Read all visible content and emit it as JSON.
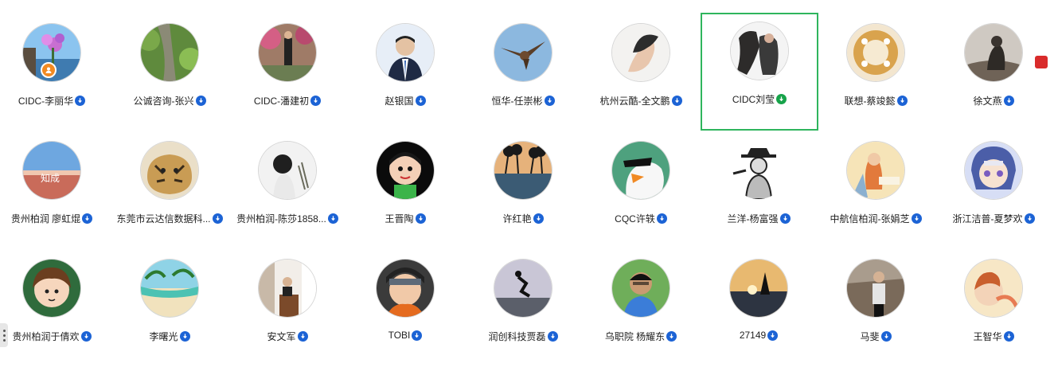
{
  "contacts": [
    {
      "name": "CIDC-李丽华",
      "badge": "blue",
      "selected": false
    },
    {
      "name": "公诚咨询-张兴",
      "badge": "blue",
      "selected": false
    },
    {
      "name": "CIDC-潘建初",
      "badge": "blue",
      "selected": false
    },
    {
      "name": "赵银国",
      "badge": "blue",
      "selected": false
    },
    {
      "name": "恒华-任崇彬",
      "badge": "blue",
      "selected": false
    },
    {
      "name": "杭州云酷-全文鹏",
      "badge": "blue",
      "selected": false
    },
    {
      "name": "CIDC刘莹",
      "badge": "green",
      "selected": true
    },
    {
      "name": "联想-蔡竣懿",
      "badge": "blue",
      "selected": false
    },
    {
      "name": "徐文燕",
      "badge": "blue",
      "selected": false
    },
    {
      "name": "贵州柏润 廖虹焜",
      "badge": "blue",
      "selected": false
    },
    {
      "name": "东莞市云达信数据科...",
      "badge": "blue",
      "selected": false
    },
    {
      "name": "贵州柏润-陈莎1858...",
      "badge": "blue",
      "selected": false
    },
    {
      "name": "王晋陶",
      "badge": "blue",
      "selected": false
    },
    {
      "name": "许红艳",
      "badge": "blue",
      "selected": false
    },
    {
      "name": "CQC许轶",
      "badge": "blue",
      "selected": false
    },
    {
      "name": "兰洋-杨富强",
      "badge": "blue",
      "selected": false
    },
    {
      "name": "中航信柏润-张娟芝",
      "badge": "blue",
      "selected": false
    },
    {
      "name": "浙江洁普-夏梦欢",
      "badge": "blue",
      "selected": false
    },
    {
      "name": "贵州柏润于倩欢",
      "badge": "blue",
      "selected": false
    },
    {
      "name": "李曙光",
      "badge": "blue",
      "selected": false
    },
    {
      "name": "安文军",
      "badge": "blue",
      "selected": false
    },
    {
      "name": "TOBI",
      "badge": "blue",
      "selected": false
    },
    {
      "name": "润创科技贾磊",
      "badge": "blue",
      "selected": false
    },
    {
      "name": "乌职院 杨耀东",
      "badge": "blue",
      "selected": false
    },
    {
      "name": "27149",
      "badge": "blue",
      "selected": false
    },
    {
      "name": "马斐",
      "badge": "blue",
      "selected": false
    },
    {
      "name": "王智华",
      "badge": "blue",
      "selected": false
    }
  ],
  "avatar_overlays": {
    "zhihe_text": "知成"
  },
  "colors": {
    "selected_border": "#2fb55d",
    "badge_blue": "#1c63d5",
    "badge_green": "#17a34a"
  }
}
